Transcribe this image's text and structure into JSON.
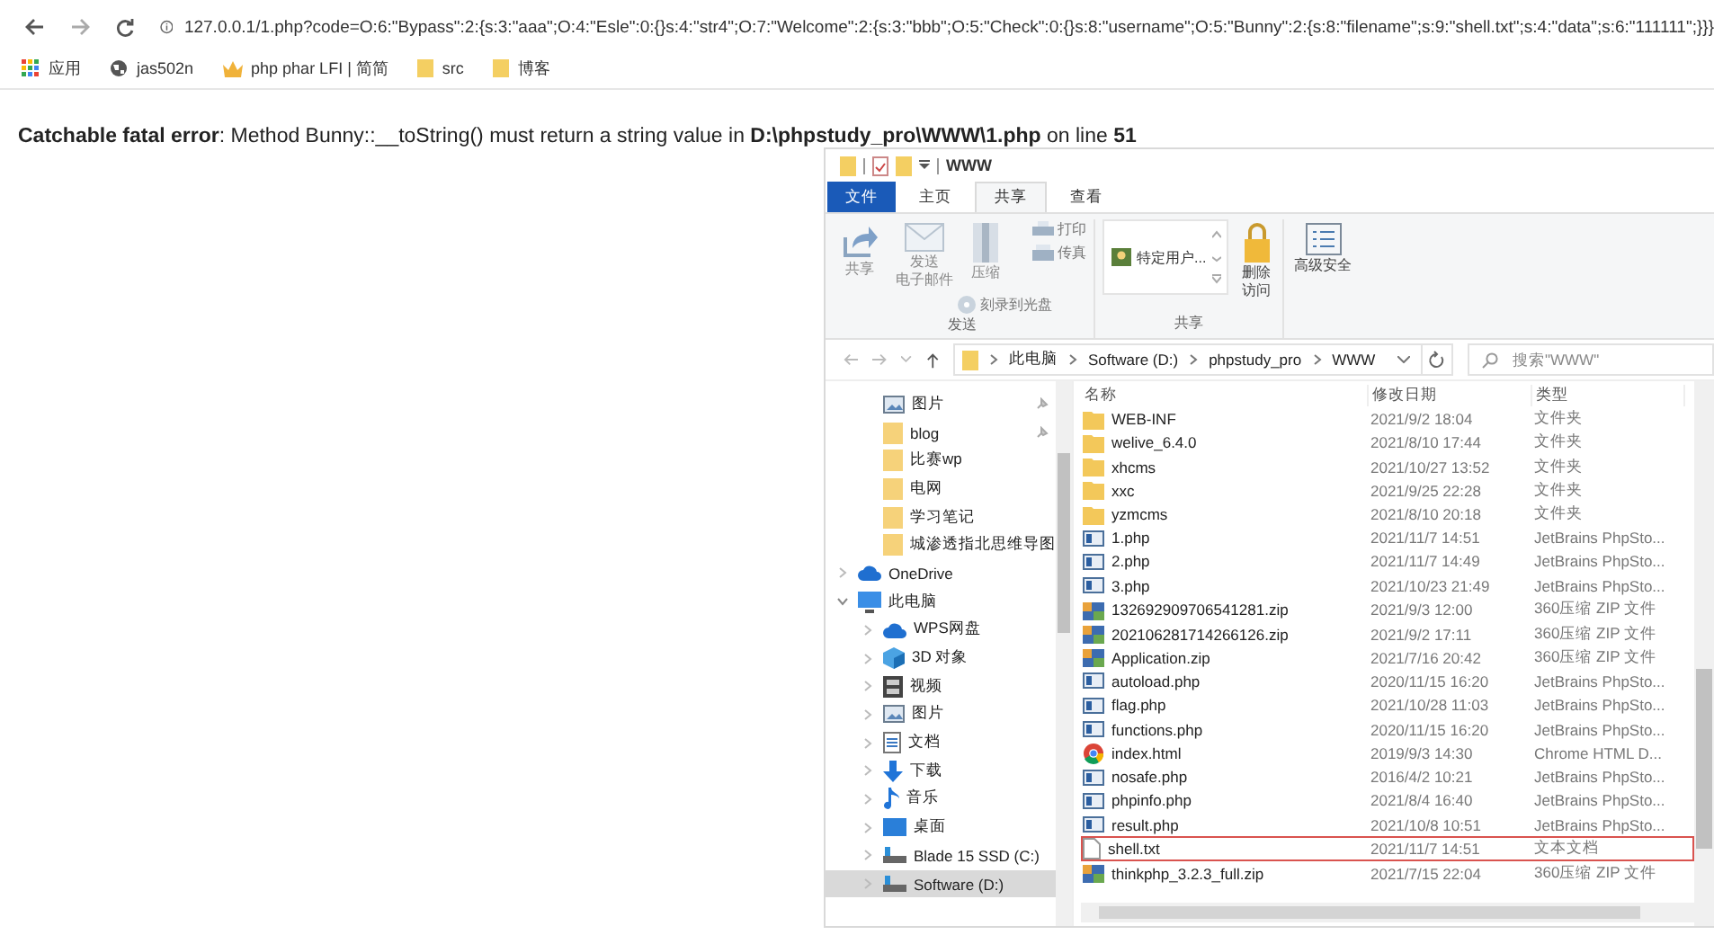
{
  "browser": {
    "url": "127.0.0.1/1.php?code=O:6:\"Bypass\":2:{s:3:\"aaa\";O:4:\"Esle\":0:{}s:4:\"str4\";O:7:\"Welcome\":2:{s:3:\"bbb\";O:5:\"Check\":0:{}s:8:\"username\";O:5:\"Bunny\":2:{s:8:\"filename\";s:9:\"shell.txt\";s:4:\"data\";s:6:\"111111\";}}}",
    "bookmarks": [
      {
        "label": "应用",
        "kind": "apps"
      },
      {
        "label": "jas502n",
        "kind": "globe"
      },
      {
        "label": "php phar LFI | 简简",
        "kind": "crown"
      },
      {
        "label": "src",
        "kind": "folder"
      },
      {
        "label": "博客",
        "kind": "folder"
      }
    ]
  },
  "error": "**Catchable fatal error**: Method Bunny::__toString() must return a string value in **D:\\phpstudy_pro\\WWW\\1.php** on line **51**",
  "explorer": {
    "title": "WWW",
    "tabs": [
      {
        "label": "文件",
        "kind": "file-menu",
        "selected": false
      },
      {
        "label": "主页",
        "kind": "tab",
        "selected": false
      },
      {
        "label": "共享",
        "kind": "tab",
        "selected": true
      },
      {
        "label": "查看",
        "kind": "tab",
        "selected": false
      }
    ],
    "ribbon": {
      "send_group": {
        "label": "发送",
        "large_buttons": [
          {
            "lines": [
              "共享"
            ],
            "kind": "share"
          },
          {
            "lines": [
              "发送",
              "电子邮件"
            ],
            "kind": "mail"
          },
          {
            "lines": [
              "压缩"
            ],
            "kind": "zip"
          }
        ],
        "small_buttons": [
          {
            "label": "打印",
            "kind": "print"
          },
          {
            "label": "传真",
            "kind": "fax"
          },
          {
            "label": "刻录到光盘",
            "kind": "disc"
          }
        ]
      },
      "share_group": {
        "label": "共享",
        "share_with": "特定用户...",
        "large_buttons": [
          {
            "lines": [
              "删除",
              "访问"
            ],
            "kind": "lock"
          }
        ]
      },
      "security": {
        "lines": [
          "高级安全"
        ],
        "kind": "security"
      }
    },
    "address": {
      "crumbs": [
        "此电脑",
        "Software (D:)",
        "phpstudy_pro",
        "WWW"
      ],
      "search_placeholder": "搜索\"WWW\""
    },
    "nav": [
      {
        "label": "图片",
        "kind": "image",
        "pinned": true,
        "selected": false
      },
      {
        "label": "blog",
        "kind": "folder",
        "pinned": true,
        "selected": false
      },
      {
        "label": "比赛wp",
        "kind": "folder",
        "pinned": false,
        "selected": false
      },
      {
        "label": "电网",
        "kind": "folder",
        "pinned": false,
        "selected": false
      },
      {
        "label": "学习笔记",
        "kind": "folder",
        "pinned": false,
        "selected": false
      },
      {
        "label": "城渗透指北思维导图",
        "kind": "folder",
        "pinned": false,
        "selected": false
      },
      {
        "label": "OneDrive",
        "kind": "cloud",
        "expanded": false,
        "selected": false
      },
      {
        "label": "此电脑",
        "kind": "computer",
        "expanded": true,
        "selected": false,
        "children": [
          {
            "label": "WPS网盘",
            "kind": "cloud",
            "expanded": false,
            "selected": false
          },
          {
            "label": "3D 对象",
            "kind": "cube",
            "expanded": false,
            "selected": false
          },
          {
            "label": "视频",
            "kind": "film",
            "expanded": false,
            "selected": false
          },
          {
            "label": "图片",
            "kind": "image",
            "expanded": false,
            "selected": false
          },
          {
            "label": "文档",
            "kind": "document",
            "expanded": false,
            "selected": false
          },
          {
            "label": "下载",
            "kind": "download",
            "expanded": false,
            "selected": false
          },
          {
            "label": "音乐",
            "kind": "music",
            "expanded": false,
            "selected": false
          },
          {
            "label": "桌面",
            "kind": "desktop",
            "expanded": false,
            "selected": false
          },
          {
            "label": "Blade 15 SSD (C:)",
            "kind": "drive",
            "expanded": false,
            "selected": false
          },
          {
            "label": "Software (D:)",
            "kind": "drive",
            "expanded": false,
            "selected": true
          }
        ]
      }
    ],
    "files": {
      "columns": [
        "名称",
        "修改日期",
        "类型"
      ],
      "rows": [
        {
          "name": "WEB-INF",
          "date": "2021/9/2 18:04",
          "type": "文件夹",
          "kind": "folder",
          "highlighted": false
        },
        {
          "name": "welive_6.4.0",
          "date": "2021/8/10 17:44",
          "type": "文件夹",
          "kind": "folder",
          "highlighted": false
        },
        {
          "name": "xhcms",
          "date": "2021/10/27 13:52",
          "type": "文件夹",
          "kind": "folder",
          "highlighted": false
        },
        {
          "name": "xxc",
          "date": "2021/9/25 22:28",
          "type": "文件夹",
          "kind": "folder",
          "highlighted": false
        },
        {
          "name": "yzmcms",
          "date": "2021/8/10 20:18",
          "type": "文件夹",
          "kind": "folder",
          "highlighted": false
        },
        {
          "name": "1.php",
          "date": "2021/11/7 14:51",
          "type": "JetBrains PhpSto...",
          "kind": "php",
          "highlighted": false
        },
        {
          "name": "2.php",
          "date": "2021/11/7 14:49",
          "type": "JetBrains PhpSto...",
          "kind": "php",
          "highlighted": false
        },
        {
          "name": "3.php",
          "date": "2021/10/23 21:49",
          "type": "JetBrains PhpSto...",
          "kind": "php",
          "highlighted": false
        },
        {
          "name": "132692909706541281.zip",
          "date": "2021/9/3 12:00",
          "type": "360压缩 ZIP 文件",
          "kind": "zip",
          "highlighted": false
        },
        {
          "name": "202106281714266126.zip",
          "date": "2021/9/2 17:11",
          "type": "360压缩 ZIP 文件",
          "kind": "zip",
          "highlighted": false
        },
        {
          "name": "Application.zip",
          "date": "2021/7/16 20:42",
          "type": "360压缩 ZIP 文件",
          "kind": "zip",
          "highlighted": false
        },
        {
          "name": "autoload.php",
          "date": "2020/11/15 16:20",
          "type": "JetBrains PhpSto...",
          "kind": "php",
          "highlighted": false
        },
        {
          "name": "flag.php",
          "date": "2021/10/28 11:03",
          "type": "JetBrains PhpSto...",
          "kind": "php",
          "highlighted": false
        },
        {
          "name": "functions.php",
          "date": "2020/11/15 16:20",
          "type": "JetBrains PhpSto...",
          "kind": "php",
          "highlighted": false
        },
        {
          "name": "index.html",
          "date": "2019/9/3 14:30",
          "type": "Chrome HTML D...",
          "kind": "html",
          "highlighted": false
        },
        {
          "name": "nosafe.php",
          "date": "2016/4/2 10:21",
          "type": "JetBrains PhpSto...",
          "kind": "php",
          "highlighted": false
        },
        {
          "name": "phpinfo.php",
          "date": "2021/8/4 16:40",
          "type": "JetBrains PhpSto...",
          "kind": "php",
          "highlighted": false
        },
        {
          "name": "result.php",
          "date": "2021/10/8 10:51",
          "type": "JetBrains PhpSto...",
          "kind": "php",
          "highlighted": false
        },
        {
          "name": "shell.txt",
          "date": "2021/11/7 14:51",
          "type": "文本文档",
          "kind": "txt",
          "highlighted": true
        },
        {
          "name": "thinkphp_3.2.3_full.zip",
          "date": "2021/7/15 22:04",
          "type": "360压缩 ZIP 文件",
          "kind": "zip",
          "highlighted": false
        }
      ]
    }
  }
}
